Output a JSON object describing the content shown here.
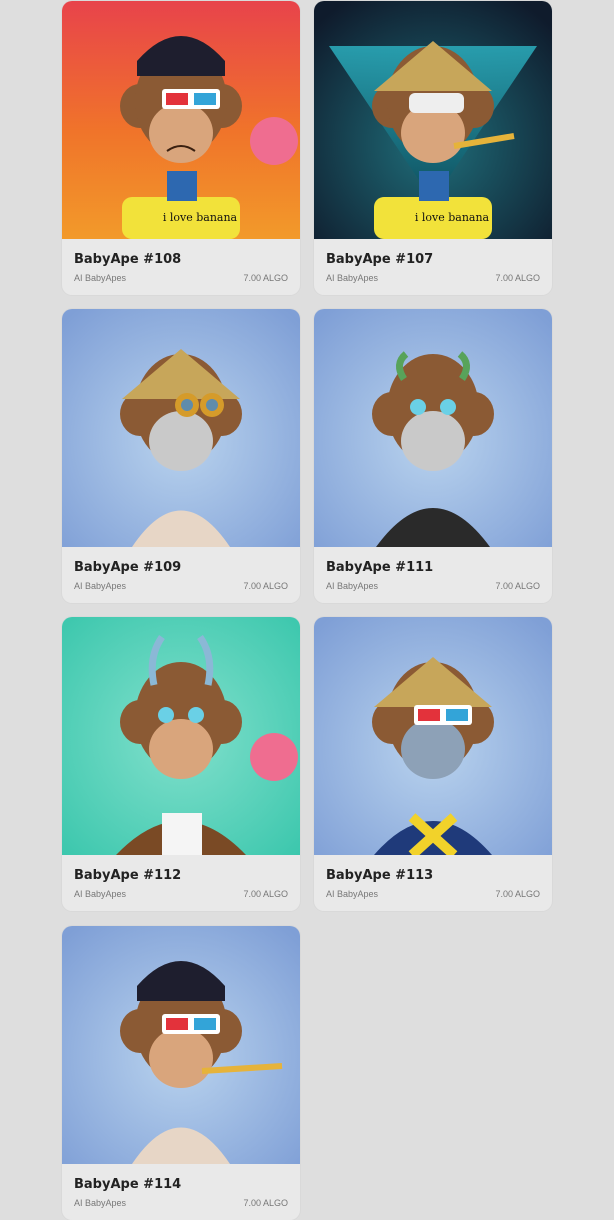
{
  "nfts": [
    {
      "title": "BabyApe #108",
      "collection": "AI BabyApes",
      "price": "7.00 ALGO",
      "background": "sunset-gradient",
      "hat": "black cap",
      "eyewear": "3d glasses",
      "mouth": "bubblegum",
      "outfit": "yellow tee",
      "shirt_text": "i love banana"
    },
    {
      "title": "BabyApe #107",
      "collection": "AI BabyApes",
      "price": "7.00 ALGO",
      "background": "teal triangle",
      "hat": "conical straw hat",
      "eyewear": "bandage",
      "mouth": "party horn",
      "outfit": "yellow tee",
      "shirt_text": "i love banana"
    },
    {
      "title": "BabyApe #109",
      "collection": "AI BabyApes",
      "price": "7.00 ALGO",
      "background": "blue",
      "hat": "conical straw hat",
      "eyewear": "steampunk goggles",
      "mouth": "robot beak",
      "outfit": "bare torn chest"
    },
    {
      "title": "BabyApe #111",
      "collection": "AI BabyApes",
      "price": "7.00 ALGO",
      "background": "blue",
      "hat": "green horns",
      "eyewear": "cyber eyes",
      "mouth": "robot beak",
      "outfit": "black jacket"
    },
    {
      "title": "BabyApe #112",
      "collection": "AI BabyApes",
      "price": "7.00 ALGO",
      "background": "teal",
      "hat": "ice horns",
      "eyewear": "cyber eyes",
      "mouth": "bubblegum",
      "outfit": "brown leather jacket"
    },
    {
      "title": "BabyApe #113",
      "collection": "AI BabyApes",
      "price": "7.00 ALGO",
      "background": "blue",
      "hat": "conical straw hat",
      "eyewear": "3d glasses",
      "mouth": "skull mask",
      "outfit": "x suit"
    },
    {
      "title": "BabyApe #114",
      "collection": "AI BabyApes",
      "price": "7.00 ALGO",
      "background": "blue",
      "hat": "black cap",
      "eyewear": "3d glasses",
      "mouth": "party horn",
      "outfit": "bare torn chest"
    }
  ],
  "colors": {
    "page_bg": "#dedede",
    "card_bg": "#e9e9e9",
    "fur": "#8b5a34",
    "face": "#d9a57c"
  }
}
